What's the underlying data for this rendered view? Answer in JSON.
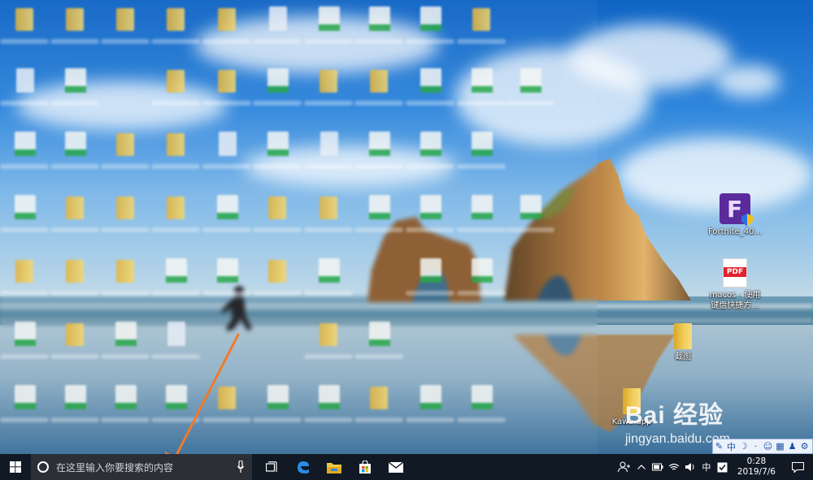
{
  "desktop": {
    "icons": [
      {
        "label": "Fortnite_40..."
      },
      {
        "label_line1": "macos - 使用",
        "label_line2": "键盘快捷方..."
      },
      {
        "label": "截图"
      },
      {
        "label": "Kawa.app"
      }
    ],
    "blurred_grid": {
      "note_icons": "blurred file and folder icons"
    }
  },
  "watermark": {
    "brand": "Bai  经验",
    "site": "jingyan.baidu.com"
  },
  "ime": {
    "items": [
      "中",
      "·",
      "⚙"
    ]
  },
  "taskbar": {
    "search_placeholder": "在这里输入你要搜索的内容",
    "tray": {
      "input_mode": "中",
      "time": "0:28",
      "date": "2019/7/6"
    }
  },
  "icons": {
    "start": "windows-start-icon",
    "search": "cortana-circle-icon",
    "mic": "microphone-icon",
    "task_view": "task-view-icon",
    "edge": "edge-browser-icon",
    "explorer": "file-explorer-icon",
    "store": "store-icon",
    "mail": "mail-icon"
  },
  "colors": {
    "taskbar": "#101924",
    "search_box": "#2c2f35",
    "arrow": "#f07a2a"
  }
}
